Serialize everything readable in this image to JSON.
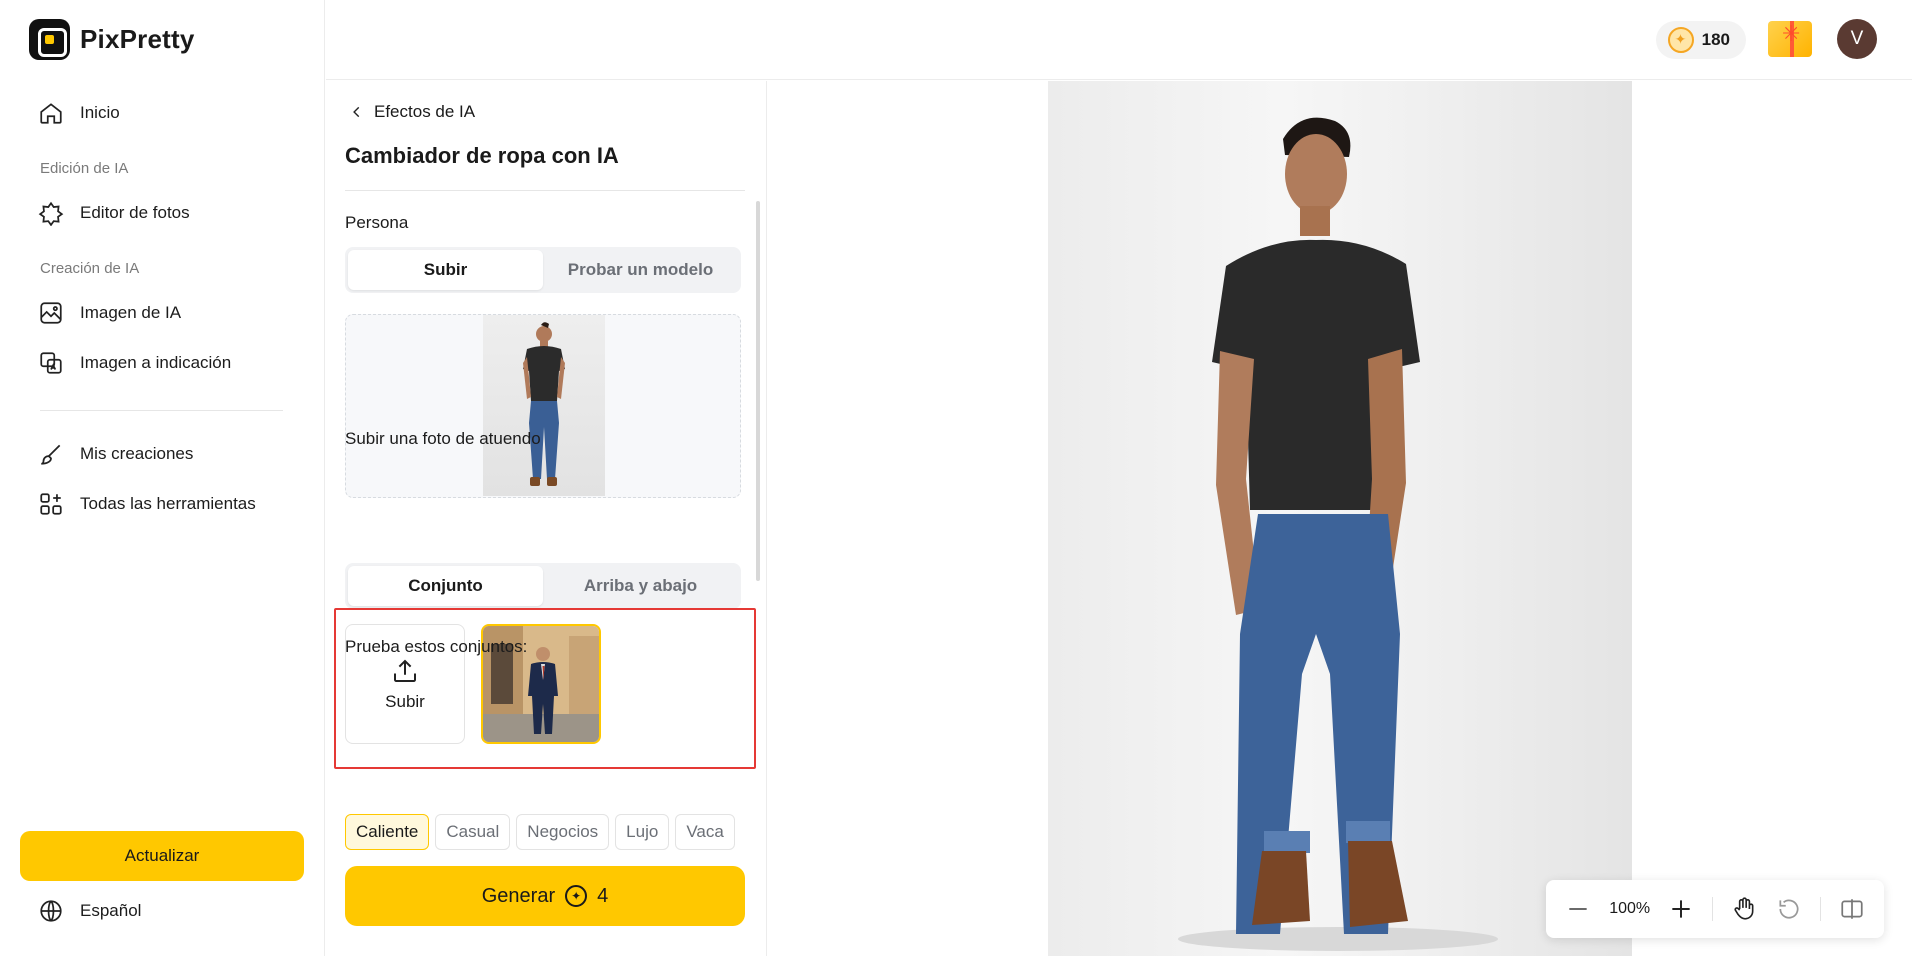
{
  "app": {
    "name": "PixPretty"
  },
  "sidebar": {
    "home_label": "Inicio",
    "section_editing": "Edición de IA",
    "photo_editor_label": "Editor de fotos",
    "section_creation": "Creación de IA",
    "ai_image_label": "Imagen de IA",
    "image_to_prompt_label": "Imagen a indicación",
    "my_creations_label": "Mis creaciones",
    "all_tools_label": "Todas las herramientas",
    "upgrade_label": "Actualizar",
    "language_label": "Español"
  },
  "header": {
    "credits": "180",
    "avatar_initial": "V"
  },
  "panel": {
    "back_label": "Efectos de IA",
    "title": "Cambiador de ropa con IA",
    "person_label": "Persona",
    "person_tabs": [
      "Subir",
      "Probar un modelo"
    ],
    "outfit_label": "Subir una foto de atuendo",
    "outfit_tabs": [
      "Conjunto",
      "Arriba y abajo"
    ],
    "upload_tile_label": "Subir",
    "try_outfits_label": "Prueba estos conjuntos:",
    "outfit_chips": [
      "Caliente",
      "Casual",
      "Negocios",
      "Lujo",
      "Vaca"
    ],
    "generate_label": "Generar",
    "generate_cost": "4"
  },
  "canvas": {
    "zoom": "100%"
  },
  "colors": {
    "accent": "#ffc800",
    "highlight": "#e53935"
  },
  "icons": [
    "home-icon",
    "photo-edit-icon",
    "ai-image-icon",
    "image-prompt-icon",
    "brush-icon",
    "tools-grid-icon",
    "globe-icon",
    "coin-icon",
    "gift-icon",
    "chevron-left-icon",
    "upload-icon",
    "zoom-out-icon",
    "zoom-in-icon",
    "hand-icon",
    "reset-icon",
    "compare-icon"
  ]
}
